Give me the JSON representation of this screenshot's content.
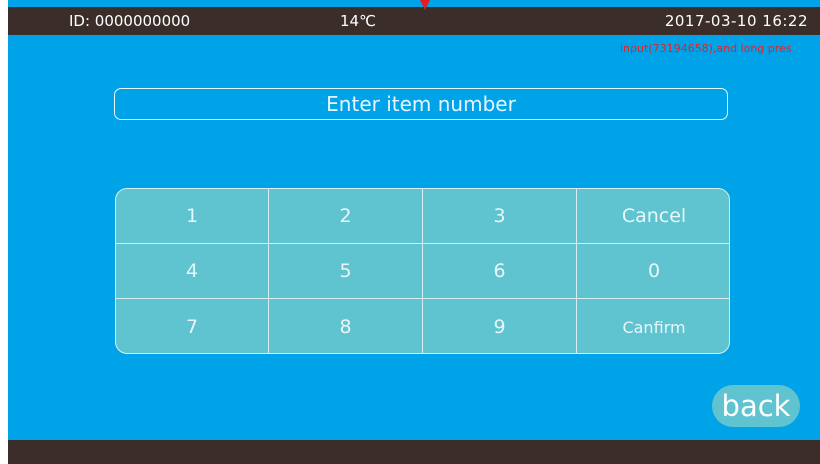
{
  "status_bar": {
    "device_id": "ID: 0000000000",
    "temperature": "14℃",
    "datetime": "2017-03-10  16:22"
  },
  "hint_text": "input(73194658),and long pres",
  "input": {
    "placeholder": "Enter item number",
    "value": ""
  },
  "keypad": {
    "keys": [
      "1",
      "2",
      "3",
      "Cancel",
      "4",
      "5",
      "6",
      "0",
      "7",
      "8",
      "9",
      "Canfirm"
    ]
  },
  "back_label": "back",
  "colors": {
    "screen_bg": "#00a3e8",
    "bar_bg": "#3b2e2a",
    "keypad_bg": "#5fc3d0",
    "hint_text": "#d9262c",
    "marker": "#e51b23"
  }
}
